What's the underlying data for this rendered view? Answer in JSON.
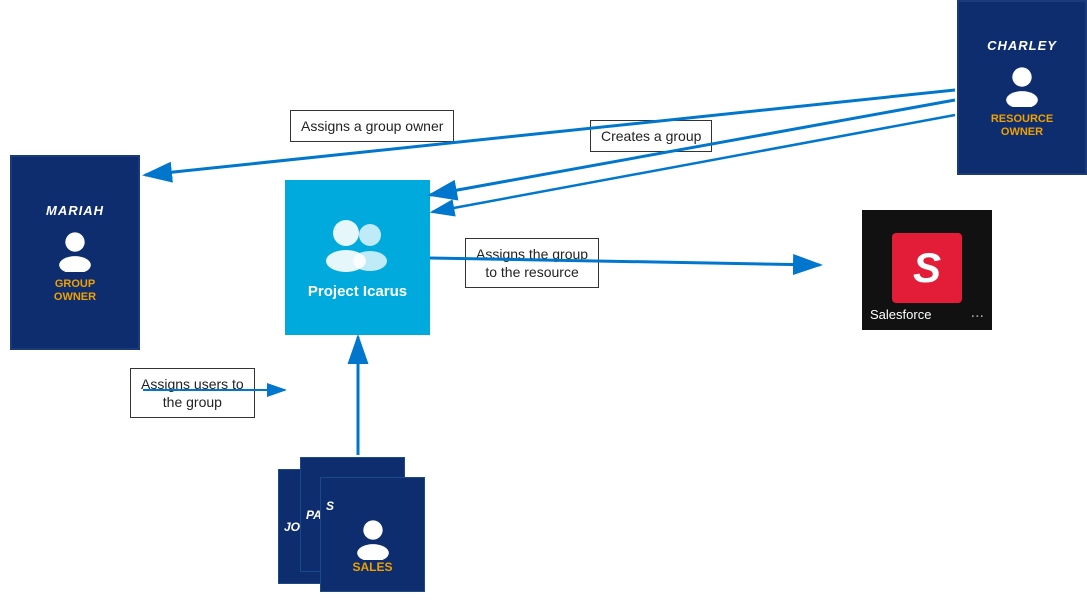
{
  "charley": {
    "name": "CHARLEY",
    "role": "RESOURCE\nOWNER"
  },
  "mariah": {
    "name": "MARIAH",
    "role": "GROUP\nOWNER"
  },
  "projectIcarus": {
    "label": "Project Icarus"
  },
  "salesforce": {
    "name": "Salesforce",
    "dots": "...",
    "logo": "S"
  },
  "users": [
    {
      "name": "JOHN",
      "role": ""
    },
    {
      "name": "PAUL",
      "role": ""
    },
    {
      "name": "SALES",
      "role": ""
    }
  ],
  "arrows": {
    "assignsGroupOwner": "Assigns a group owner",
    "createsGroup": "Creates a group",
    "assignsGroupToResource": "Assigns the group\nto the resource",
    "assignsUsersToGroup": "Assigns users to\nthe group"
  }
}
